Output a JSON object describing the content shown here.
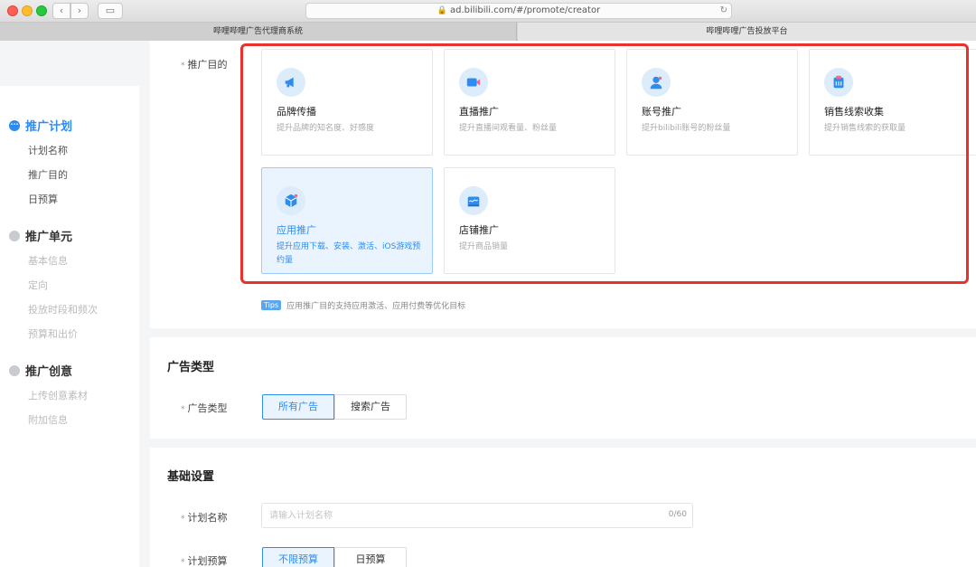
{
  "browser": {
    "url": "ad.bilibili.com/#/promote/creator",
    "tabs": [
      "哔哩哔哩广告代理商系统",
      "哔哩哔哩广告投放平台"
    ]
  },
  "sidebar": {
    "steps": [
      {
        "label": "推广计划",
        "active": true,
        "subs": [
          "计划名称",
          "推广目的",
          "日预算"
        ]
      },
      {
        "label": "推广单元",
        "active": false,
        "subs": [
          "基本信息",
          "定向",
          "投放时段和频次",
          "预算和出价"
        ]
      },
      {
        "label": "推广创意",
        "active": false,
        "subs": [
          "上传创意素材",
          "附加信息"
        ]
      }
    ]
  },
  "purpose": {
    "label": "推广目的",
    "cards": [
      {
        "title": "品牌传播",
        "desc": "提升品牌的知名度、好感度",
        "icon": "megaphone-icon"
      },
      {
        "title": "直播推广",
        "desc": "提升直播间观看量、粉丝量",
        "icon": "video-icon"
      },
      {
        "title": "账号推广",
        "desc": "提升bilibili账号的粉丝量",
        "icon": "user-icon"
      },
      {
        "title": "销售线索收集",
        "desc": "提升销售线索的获取量",
        "icon": "clipboard-icon"
      },
      {
        "title": "应用推广",
        "desc": "提升应用下载、安装、激活、iOS游戏预约量",
        "icon": "app-cube-icon",
        "selected": true
      },
      {
        "title": "店铺推广",
        "desc": "提升商品销量",
        "icon": "shop-icon"
      }
    ],
    "tip_badge": "Tips",
    "tip_text": "应用推广目的支持应用激活、应用付费等优化目标"
  },
  "ad_type": {
    "section_title": "广告类型",
    "label": "广告类型",
    "options": [
      "所有广告",
      "搜索广告"
    ],
    "selected": "所有广告"
  },
  "basic": {
    "section_title": "基础设置",
    "name_label": "计划名称",
    "name_placeholder": "请输入计划名称",
    "name_counter": "0/60",
    "budget_label": "计划预算",
    "budget_options": [
      "不限预算",
      "日预算"
    ],
    "budget_selected": "不限预算"
  },
  "colors": {
    "accent": "#2d8cf0",
    "highlight_border": "#e8322e"
  }
}
